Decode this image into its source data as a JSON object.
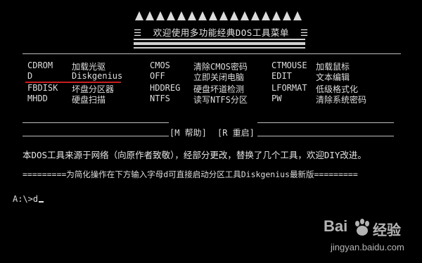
{
  "title": "☰  欢迎使用多功能经典DOS工具菜单  ☰",
  "menu": {
    "col1": [
      {
        "key": "CDROM",
        "label": "加载光驱"
      },
      {
        "key": "D",
        "label": "Diskgenius"
      },
      {
        "key": "FBDISK",
        "label": "坏盘分区器"
      },
      {
        "key": "MHDD",
        "label": "硬盘扫描"
      }
    ],
    "col2": [
      {
        "key": "CMOS",
        "label": "清除CMOS密码"
      },
      {
        "key": "OFF",
        "label": "立即关闭电脑"
      },
      {
        "key": "HDDREG",
        "label": "硬盘坏道检测"
      },
      {
        "key": "NTFS",
        "label": "读写NTFS分区"
      }
    ],
    "col3": [
      {
        "key": "CTMOUSE",
        "label": "加载鼠标"
      },
      {
        "key": "EDIT",
        "label": "文本编辑"
      },
      {
        "key": "LFORMAT",
        "label": "低级格式化"
      },
      {
        "key": "PW",
        "label": "清除系统密码"
      }
    ]
  },
  "footer": {
    "help": "[M 帮助]",
    "restart": "[R 重启]"
  },
  "notice": "本DOS工具来源于网络（向原作者致敬），经部分更改，替换了几个工具，欢迎DIY改进。",
  "instruction": "=========为简化操作在下方输入字母d可直接启动分区工具Diskgenius最新版=========",
  "prompt": "A:\\>d",
  "watermark": {
    "brand": "Bai",
    "brand2": "经验",
    "url": "jingyan.baidu.com"
  },
  "colors": {
    "background": "#000000",
    "text": "#d8d8d8",
    "selection_underline": "#c81e1e"
  }
}
